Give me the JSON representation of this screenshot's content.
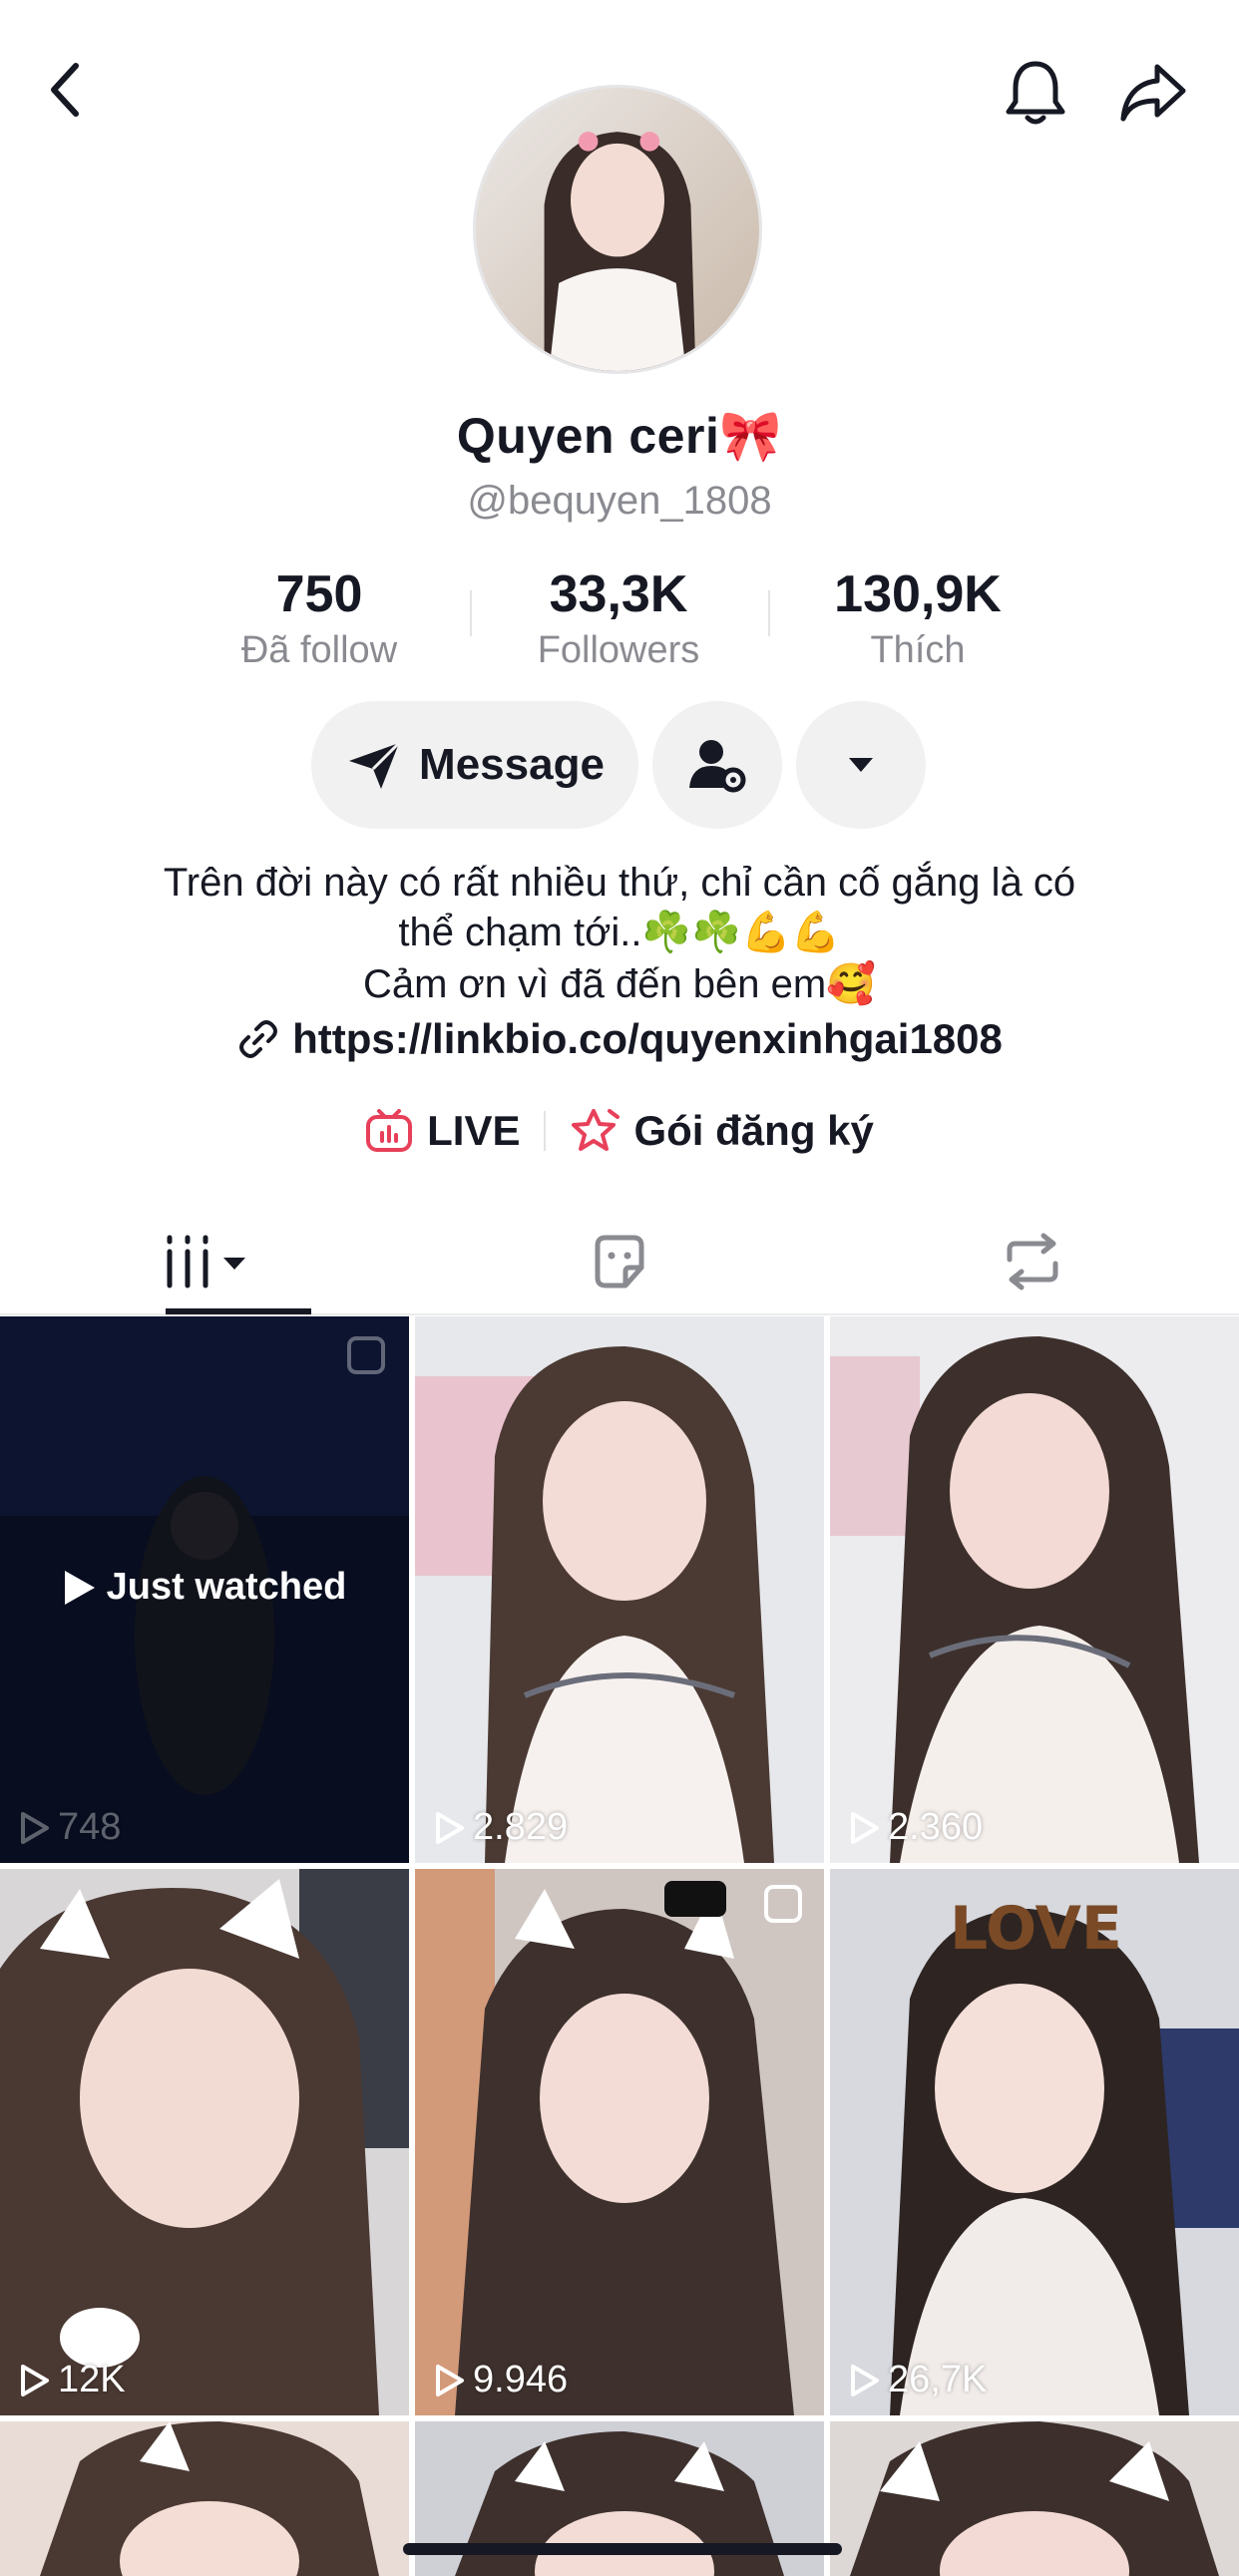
{
  "profile": {
    "display_name": "Quyen ceri🎀",
    "handle": "@bequyen_1808",
    "stats": [
      {
        "value": "750",
        "label": "Đã follow"
      },
      {
        "value": "33,3K",
        "label": "Followers"
      },
      {
        "value": "130,9K",
        "label": "Thích"
      }
    ],
    "actions": {
      "message_label": "Message"
    },
    "bio_lines": [
      "Trên đời này có rất nhiều thứ, chỉ cần cố gắng là có",
      "thể chạm tới..☘️☘️💪💪",
      "Cảm ơn vì đã đến bên em🥰"
    ],
    "link": "https://linkbio.co/quyenxinhgai1808",
    "live_label": "LIVE",
    "subscription_label": "Gói đăng ký"
  },
  "header": {
    "back_icon": "chevron-left-icon",
    "bell_icon": "bell-icon",
    "share_icon": "share-icon"
  },
  "tabs": [
    {
      "icon": "videos-grid-icon"
    },
    {
      "icon": "liked-sticker-icon"
    },
    {
      "icon": "repost-icon"
    }
  ],
  "videos": [
    {
      "views": "748",
      "overlay": "Just watched"
    },
    {
      "views": "2.829"
    },
    {
      "views": "2.360"
    },
    {
      "views": "12K"
    },
    {
      "views": "9.946"
    },
    {
      "views": "26,7K"
    },
    {
      "views": ""
    },
    {
      "views": ""
    },
    {
      "views": ""
    }
  ],
  "colors": {
    "accent_pink": "#e8405a",
    "text_primary": "#161823",
    "text_secondary": "#8a8b91",
    "pill_bg": "#f1f1f2"
  }
}
